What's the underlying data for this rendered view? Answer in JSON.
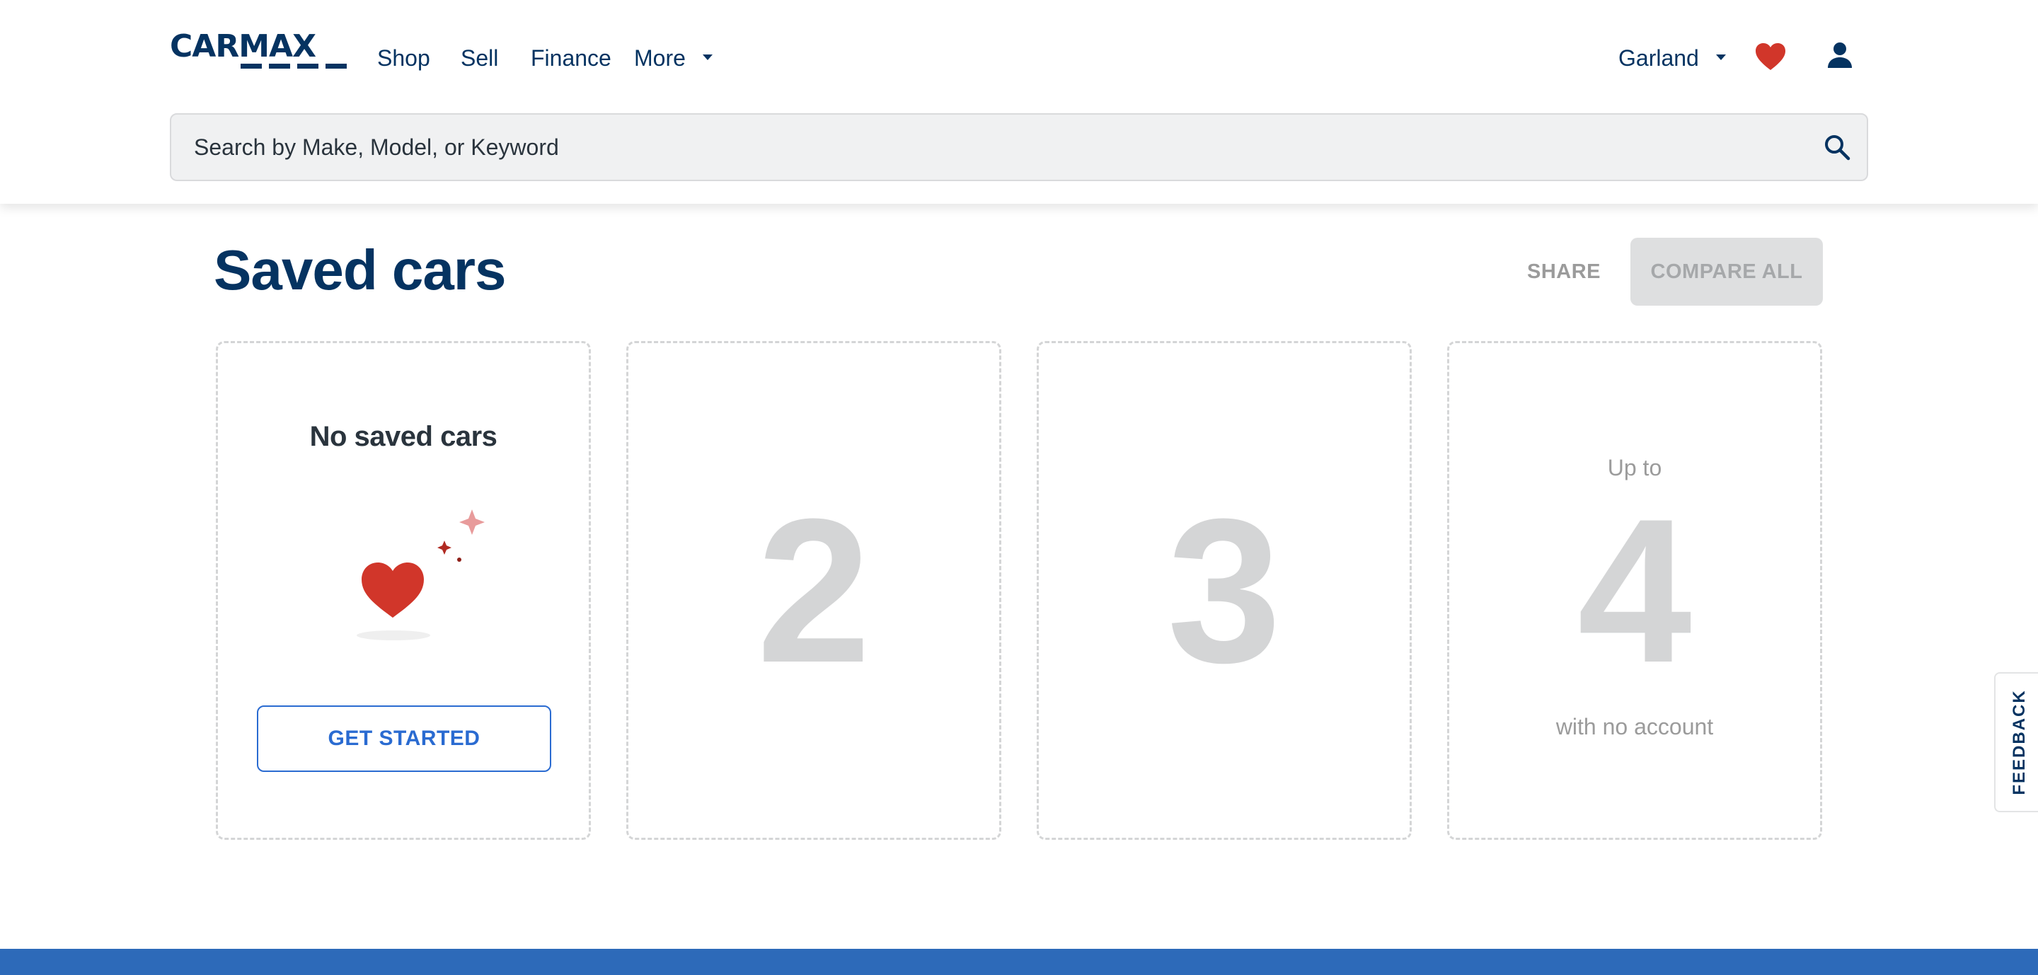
{
  "header": {
    "logo": "CARMAX",
    "nav": [
      {
        "label": "Shop"
      },
      {
        "label": "Sell"
      },
      {
        "label": "Finance"
      },
      {
        "label": "More"
      }
    ],
    "location": "Garland",
    "icons": {
      "favorites": "heart-icon",
      "account": "user-icon",
      "search": "search-icon"
    }
  },
  "search": {
    "placeholder": "Search by Make, Model, or Keyword",
    "value": ""
  },
  "page": {
    "title": "Saved cars",
    "share_label": "SHARE",
    "compare_all_label": "COMPARE ALL"
  },
  "slots": {
    "first": {
      "title": "No saved cars",
      "cta_label": "GET STARTED"
    },
    "second": {
      "number": "2"
    },
    "third": {
      "number": "3"
    },
    "fourth": {
      "upto": "Up to",
      "number": "4",
      "caption": "with no account"
    }
  },
  "feedback": {
    "label": "FEEDBACK"
  },
  "colors": {
    "brand_navy": "#053361",
    "heart_red": "#d1362a",
    "link_blue": "#2a6bd1",
    "placeholder_gray": "#d4d5d6",
    "footer_blue": "#2d6ab9"
  }
}
